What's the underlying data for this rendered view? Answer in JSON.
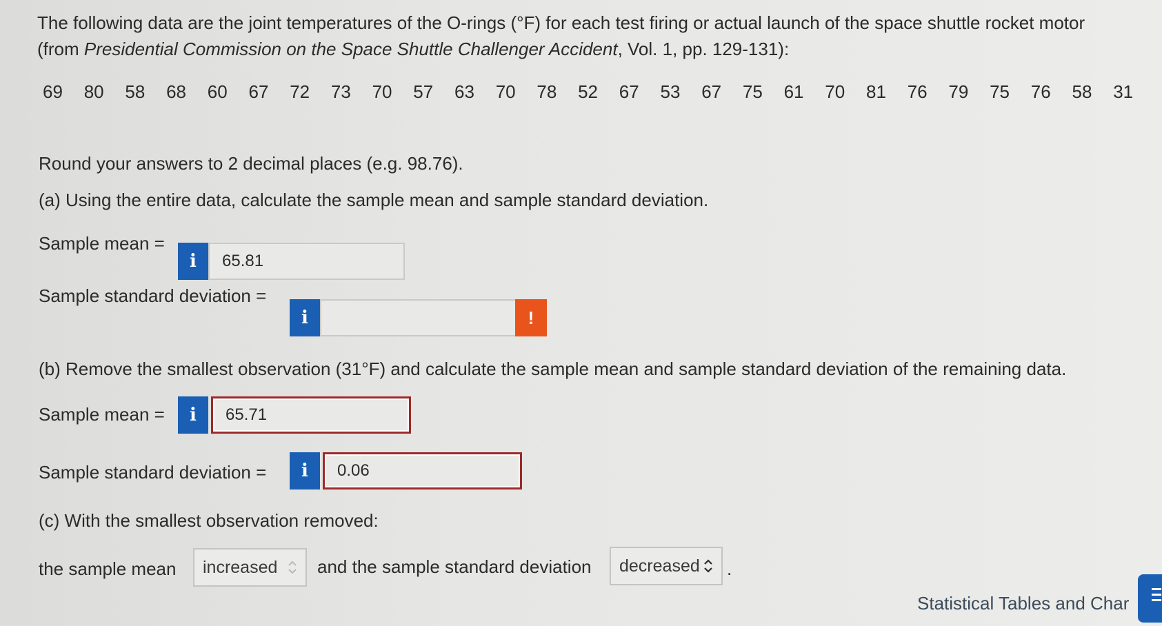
{
  "question": {
    "intro_line1": "The following data are the joint temperatures of the O-rings (°F) for each test firing or actual launch of the space shuttle rocket motor",
    "intro_line2_prefix": "(from ",
    "intro_source": "Presidential Commission on the Space Shuttle Challenger Accident",
    "intro_line2_suffix": ", Vol. 1, pp. 129-131):",
    "data_values": [
      "69",
      "80",
      "58",
      "68",
      "60",
      "67",
      "72",
      "73",
      "70",
      "57",
      "63",
      "70",
      "78",
      "52",
      "67",
      "53",
      "67",
      "75",
      "61",
      "70",
      "81",
      "76",
      "79",
      "75",
      "76",
      "58",
      "31"
    ],
    "round_instruction": "Round your answers to 2 decimal places (e.g. 98.76).",
    "part_a": "(a) Using the entire data, calculate the sample mean and sample standard deviation.",
    "part_b": "(b) Remove the smallest observation (31°F) and calculate the sample mean and sample standard deviation of the remaining data.",
    "part_c": "(c) With the smallest observation removed:"
  },
  "labels": {
    "sample_mean": "Sample mean =",
    "sample_sd": "Sample standard deviation =",
    "mean_phrase": "the sample mean",
    "sd_phrase": "and the sample standard deviation",
    "period": "."
  },
  "answers": {
    "a_mean": "65.81",
    "a_sd": "",
    "b_mean": "65.71",
    "b_sd": "0.06",
    "c_mean_select": "increased",
    "c_sd_select": "decreased"
  },
  "icons": {
    "info": "i",
    "warning": "!"
  },
  "footer": {
    "link": "Statistical Tables and Char"
  },
  "colors": {
    "info_blue": "#1a5fb4",
    "warning_orange": "#e8541b",
    "error_border": "#9c2a2a"
  }
}
